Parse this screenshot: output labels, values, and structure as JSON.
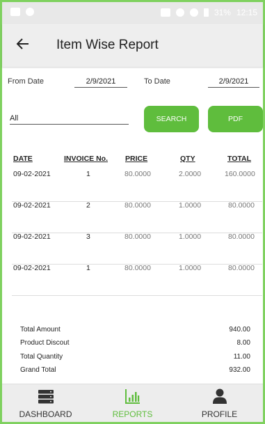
{
  "status_bar": {
    "battery": "31%",
    "time": "12:15"
  },
  "header": {
    "title": "Item Wise Report"
  },
  "filters": {
    "from_label": "From Date",
    "from_value": "2/9/2021",
    "to_label": "To Date",
    "to_value": "2/9/2021",
    "item_value": "All",
    "search_label": "SEARCH",
    "pdf_label": "PDF"
  },
  "table": {
    "headers": [
      "DATE",
      "INVOICE No.",
      "PRICE",
      "QTY",
      "TOTAL"
    ],
    "rows": [
      [
        "09-02-2021",
        "1",
        "80.0000",
        "2.0000",
        "160.0000"
      ],
      [
        "09-02-2021",
        "2",
        "80.0000",
        "1.0000",
        "80.0000"
      ],
      [
        "09-02-2021",
        "3",
        "80.0000",
        "1.0000",
        "80.0000"
      ],
      [
        "09-02-2021",
        "1",
        "80.0000",
        "1.0000",
        "80.0000"
      ]
    ]
  },
  "summary": {
    "total_amount_label": "Total Amount",
    "total_amount": "940.00",
    "discount_label": "Product Discout",
    "discount": "8.00",
    "quantity_label": "Total Quantity",
    "quantity": "11.00",
    "grand_label": "Grand Total",
    "grand": "932.00"
  },
  "nav": {
    "items": [
      {
        "label": "DASHBOARD",
        "icon": "dashboard-icon",
        "color": "#333333"
      },
      {
        "label": "REPORTS",
        "icon": "reports-icon",
        "color": "#5fbd3d"
      },
      {
        "label": "PROFILE",
        "icon": "profile-icon",
        "color": "#333333"
      }
    ]
  },
  "colors": {
    "accent": "#5fbd3d",
    "border": "#7fd15f"
  }
}
